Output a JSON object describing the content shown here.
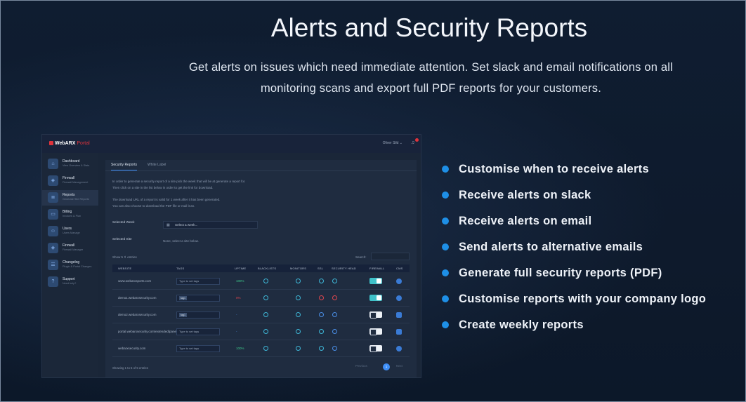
{
  "header": {
    "title": "Alerts and Security Reports",
    "subtitle": "Get alerts on issues which need immediate attention. Set slack and email notifications on all monitoring scans and export full PDF reports for your customers."
  },
  "app": {
    "logo": "WebARX",
    "logo_sub": "Portal",
    "user": "Oliver Sild ⌄",
    "sidebar": [
      {
        "label": "Dashboard",
        "sub": "View Overview & Stats",
        "icon": "home-icon"
      },
      {
        "label": "Firewall",
        "sub": "Firewall Management",
        "icon": "shield-icon"
      },
      {
        "label": "Reports",
        "sub": "Generate Site Reports",
        "icon": "report-icon",
        "active": true
      },
      {
        "label": "Billing",
        "sub": "Invoices & Plan",
        "icon": "card-icon"
      },
      {
        "label": "Users",
        "sub": "Users Manage",
        "icon": "users-icon"
      },
      {
        "label": "Firewall",
        "sub": "Firewall Manager",
        "icon": "shield-icon"
      },
      {
        "label": "Changelog",
        "sub": "Plugin & Portal Changes",
        "icon": "list-icon"
      },
      {
        "label": "Support",
        "sub": "Need help?",
        "icon": "help-icon"
      }
    ],
    "tabs": [
      "Security Reports",
      "White Label"
    ],
    "intro1": "In order to generate a security report of a site pick the week that will be at generate a report for.",
    "intro2": "Then click on a site in the list below in order to get the link for download.",
    "intro3": "The download URL of a report is valid for 1 week after it has been generated.",
    "intro4": "You can also choose to download the PDF file or mail it an.",
    "selected_week_label": "Selected Week",
    "week_placeholder": "Select a week...",
    "selected_site_label": "Selected Site",
    "selected_site_value": "None, select a site below.",
    "show": "Show  5  ⇕  entries",
    "search_label": "Search:",
    "columns": [
      "WEBSITE",
      "TAGS",
      "UPTIME",
      "BLACKLISTS",
      "MONITORS",
      "SSL",
      "SECURITY HEAD",
      "FIREWALL",
      "CMS"
    ],
    "rows": [
      {
        "website": "www.webarxsports.com",
        "tag": "Type to set tags",
        "uptime": "100%"
      },
      {
        "website": "demo1.webarxsecurity.com",
        "tag": "tag1",
        "uptime": "0%"
      },
      {
        "website": "demo2.webarxsecurity.com",
        "tag": "tag1",
        "uptime": "-"
      },
      {
        "website": "portal.webarxsecurity.com/extended/panel",
        "tag": "Type to set tags",
        "uptime": "-"
      },
      {
        "website": "webarxsecurity.com",
        "tag": "Type to set tags",
        "uptime": "100%"
      }
    ],
    "footer": "Showing 1 to 5 of 5 entries",
    "prev": "Previous",
    "page": "1",
    "next": "Next"
  },
  "features": [
    "Customise when to receive alerts",
    "Receive alerts on slack",
    "Receive alerts on email",
    "Send alerts to alternative emails",
    "Generate full security reports (PDF)",
    "Customise reports with your company logo",
    "Create weekly reports"
  ],
  "colors": {
    "accent": "#1e8fe6",
    "background": "#0d1b2e"
  }
}
